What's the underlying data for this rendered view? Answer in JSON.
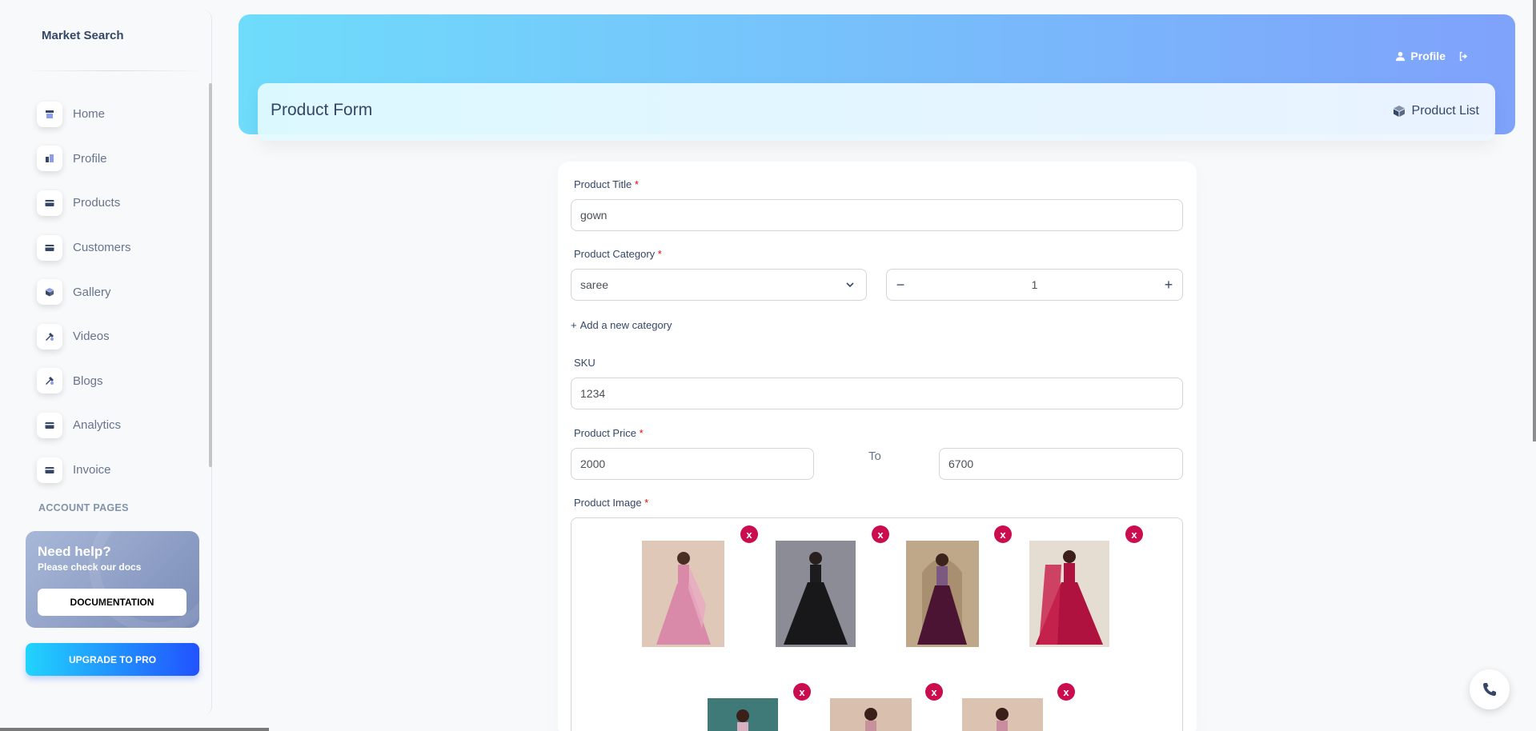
{
  "brand": "Market Search",
  "sidebar": {
    "items": [
      {
        "label": "Home",
        "icon": "shop-icon"
      },
      {
        "label": "Profile",
        "icon": "office-icon"
      },
      {
        "label": "Products",
        "icon": "credit-card-icon"
      },
      {
        "label": "Customers",
        "icon": "credit-card-icon"
      },
      {
        "label": "Gallery",
        "icon": "box-3d-icon"
      },
      {
        "label": "Videos",
        "icon": "settings-icon"
      },
      {
        "label": "Blogs",
        "icon": "settings-icon"
      },
      {
        "label": "Analytics",
        "icon": "credit-card-icon"
      },
      {
        "label": "Invoice",
        "icon": "credit-card-icon"
      }
    ],
    "section_title": "ACCOUNT PAGES",
    "help": {
      "title": "Need help?",
      "subtitle": "Please check our docs",
      "button": "DOCUMENTATION"
    },
    "upgrade": "UPGRADE TO PRO"
  },
  "topbar": {
    "profile_label": "Profile"
  },
  "header": {
    "title": "Product Form",
    "product_list_label": "Product List"
  },
  "form": {
    "title_label": "Product Title",
    "title_value": "gown",
    "category_label": "Product Category",
    "category_value": "saree",
    "quantity_value": "1",
    "add_category": "Add a new category",
    "sku_label": "SKU",
    "sku_value": "1234",
    "price_label": "Product Price",
    "price_min": "2000",
    "to_label": "To",
    "price_max": "6700",
    "image_label": "Product Image",
    "remove_label": "x",
    "required_mark": "*"
  },
  "colors": {
    "header_gradient_start": "#6fdcfb",
    "header_gradient_end": "#7fa2fb",
    "remove_badge": "#cb0c4f",
    "upgrade_start": "#21d4fd",
    "upgrade_end": "#2152ff"
  }
}
